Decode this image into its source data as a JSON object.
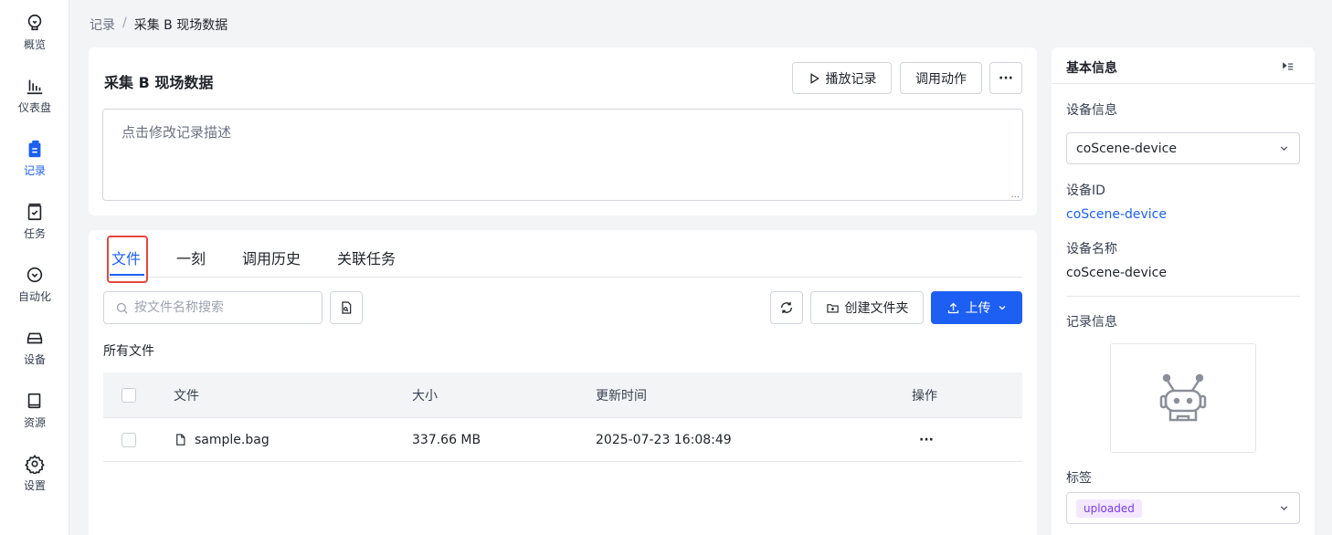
{
  "sidebar": {
    "items": [
      {
        "label": "概览",
        "icon": "bulb-icon"
      },
      {
        "label": "仪表盘",
        "icon": "chart-icon"
      },
      {
        "label": "记录",
        "icon": "record-icon"
      },
      {
        "label": "任务",
        "icon": "task-icon"
      },
      {
        "label": "自动化",
        "icon": "automation-icon"
      },
      {
        "label": "设备",
        "icon": "device-icon"
      },
      {
        "label": "资源",
        "icon": "book-icon"
      },
      {
        "label": "设置",
        "icon": "gear-icon"
      }
    ],
    "active_index": 2
  },
  "breadcrumb": {
    "parent": "记录",
    "separator": "/",
    "current": "采集 B 现场数据"
  },
  "record": {
    "title": "采集 B 现场数据",
    "description_placeholder": "点击修改记录描述",
    "play_label": "播放记录",
    "action_label": "调用动作",
    "more_label": "···"
  },
  "tabs": [
    "文件",
    "一刻",
    "调用历史",
    "关联任务"
  ],
  "files": {
    "search_placeholder": "按文件名称搜索",
    "create_folder_label": "创建文件夹",
    "upload_label": "上传",
    "section_title": "所有文件",
    "columns": [
      "文件",
      "大小",
      "更新时间",
      "操作"
    ],
    "rows": [
      {
        "name": "sample.bag",
        "size": "337.66 MB",
        "updated": "2025-07-23 16:08:49",
        "action": "···"
      }
    ]
  },
  "info_panel": {
    "title": "基本信息",
    "device_section": "设备信息",
    "device_select": "coScene-device",
    "device_id_label": "设备ID",
    "device_id": "coScene-device",
    "device_name_label": "设备名称",
    "device_name": "coScene-device",
    "record_section": "记录信息",
    "tags_label": "标签",
    "tag": "uploaded"
  },
  "colors": {
    "accent": "#1d5ff2",
    "highlight": "#e5463e",
    "tag_bg": "#f3e8ff",
    "tag_text": "#7c3aed"
  }
}
